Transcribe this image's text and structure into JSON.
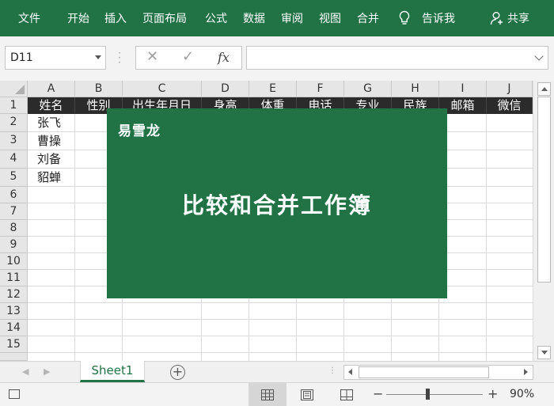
{
  "ribbon": {
    "tabs": [
      "文件",
      "开始",
      "插入",
      "页面布局",
      "公式",
      "数据",
      "审阅",
      "视图",
      "合并"
    ],
    "tell_me": "告诉我",
    "share": "共享"
  },
  "formula_bar": {
    "name_box": "D11",
    "cancel_symbol": "✕",
    "enter_symbol": "✓",
    "fx_label": "fx",
    "formula": ""
  },
  "grid": {
    "columns": [
      "A",
      "B",
      "C",
      "D",
      "E",
      "F",
      "G",
      "H",
      "I",
      "J"
    ],
    "rows": [
      "1",
      "2",
      "3",
      "4",
      "5",
      "6",
      "7",
      "8",
      "9",
      "10",
      "11",
      "12",
      "13",
      "14",
      "15"
    ],
    "header_row": [
      "姓名",
      "性别",
      "出生年月日",
      "身高",
      "体重",
      "电话",
      "专业",
      "民族",
      "邮箱",
      "微信"
    ],
    "names": [
      "张飞",
      "曹操",
      "刘备",
      "貂蝉"
    ]
  },
  "banner": {
    "logo": "易雪龙",
    "title": "比较和合并工作簿"
  },
  "sheets": {
    "tabs": [
      "Sheet1"
    ],
    "add_symbol": "+"
  },
  "status": {
    "zoom_minus": "−",
    "zoom_plus": "+",
    "zoom_percent": "90%",
    "zoom_level": 0.9
  },
  "colors": {
    "excel_green": "#217346",
    "header_row_bg": "#2b2b2b"
  },
  "icons": [
    "lightbulb-icon",
    "person-icon",
    "macro-record-icon",
    "normal-view-icon",
    "page-layout-view-icon",
    "page-break-view-icon"
  ]
}
